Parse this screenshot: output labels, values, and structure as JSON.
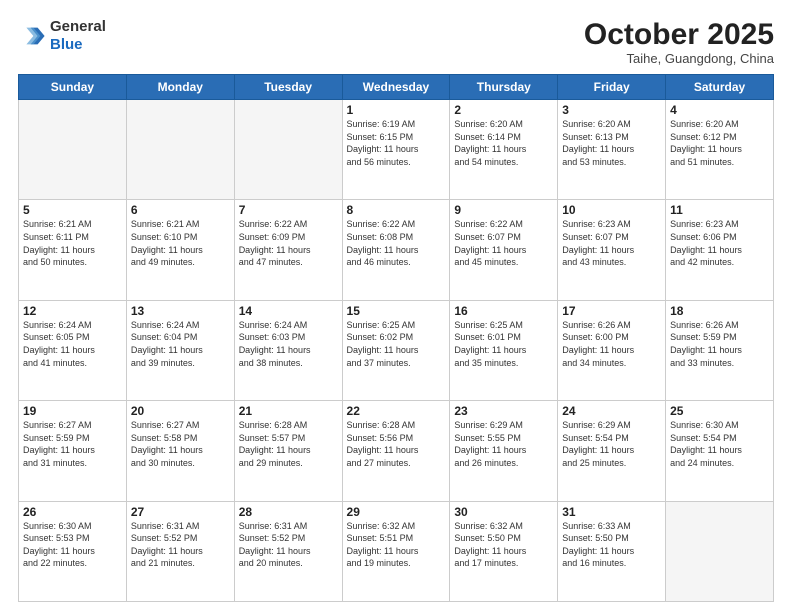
{
  "header": {
    "logo_general": "General",
    "logo_blue": "Blue",
    "month_title": "October 2025",
    "subtitle": "Taihe, Guangdong, China"
  },
  "weekdays": [
    "Sunday",
    "Monday",
    "Tuesday",
    "Wednesday",
    "Thursday",
    "Friday",
    "Saturday"
  ],
  "weeks": [
    [
      {
        "day": "",
        "info": ""
      },
      {
        "day": "",
        "info": ""
      },
      {
        "day": "",
        "info": ""
      },
      {
        "day": "1",
        "info": "Sunrise: 6:19 AM\nSunset: 6:15 PM\nDaylight: 11 hours\nand 56 minutes."
      },
      {
        "day": "2",
        "info": "Sunrise: 6:20 AM\nSunset: 6:14 PM\nDaylight: 11 hours\nand 54 minutes."
      },
      {
        "day": "3",
        "info": "Sunrise: 6:20 AM\nSunset: 6:13 PM\nDaylight: 11 hours\nand 53 minutes."
      },
      {
        "day": "4",
        "info": "Sunrise: 6:20 AM\nSunset: 6:12 PM\nDaylight: 11 hours\nand 51 minutes."
      }
    ],
    [
      {
        "day": "5",
        "info": "Sunrise: 6:21 AM\nSunset: 6:11 PM\nDaylight: 11 hours\nand 50 minutes."
      },
      {
        "day": "6",
        "info": "Sunrise: 6:21 AM\nSunset: 6:10 PM\nDaylight: 11 hours\nand 49 minutes."
      },
      {
        "day": "7",
        "info": "Sunrise: 6:22 AM\nSunset: 6:09 PM\nDaylight: 11 hours\nand 47 minutes."
      },
      {
        "day": "8",
        "info": "Sunrise: 6:22 AM\nSunset: 6:08 PM\nDaylight: 11 hours\nand 46 minutes."
      },
      {
        "day": "9",
        "info": "Sunrise: 6:22 AM\nSunset: 6:07 PM\nDaylight: 11 hours\nand 45 minutes."
      },
      {
        "day": "10",
        "info": "Sunrise: 6:23 AM\nSunset: 6:07 PM\nDaylight: 11 hours\nand 43 minutes."
      },
      {
        "day": "11",
        "info": "Sunrise: 6:23 AM\nSunset: 6:06 PM\nDaylight: 11 hours\nand 42 minutes."
      }
    ],
    [
      {
        "day": "12",
        "info": "Sunrise: 6:24 AM\nSunset: 6:05 PM\nDaylight: 11 hours\nand 41 minutes."
      },
      {
        "day": "13",
        "info": "Sunrise: 6:24 AM\nSunset: 6:04 PM\nDaylight: 11 hours\nand 39 minutes."
      },
      {
        "day": "14",
        "info": "Sunrise: 6:24 AM\nSunset: 6:03 PM\nDaylight: 11 hours\nand 38 minutes."
      },
      {
        "day": "15",
        "info": "Sunrise: 6:25 AM\nSunset: 6:02 PM\nDaylight: 11 hours\nand 37 minutes."
      },
      {
        "day": "16",
        "info": "Sunrise: 6:25 AM\nSunset: 6:01 PM\nDaylight: 11 hours\nand 35 minutes."
      },
      {
        "day": "17",
        "info": "Sunrise: 6:26 AM\nSunset: 6:00 PM\nDaylight: 11 hours\nand 34 minutes."
      },
      {
        "day": "18",
        "info": "Sunrise: 6:26 AM\nSunset: 5:59 PM\nDaylight: 11 hours\nand 33 minutes."
      }
    ],
    [
      {
        "day": "19",
        "info": "Sunrise: 6:27 AM\nSunset: 5:59 PM\nDaylight: 11 hours\nand 31 minutes."
      },
      {
        "day": "20",
        "info": "Sunrise: 6:27 AM\nSunset: 5:58 PM\nDaylight: 11 hours\nand 30 minutes."
      },
      {
        "day": "21",
        "info": "Sunrise: 6:28 AM\nSunset: 5:57 PM\nDaylight: 11 hours\nand 29 minutes."
      },
      {
        "day": "22",
        "info": "Sunrise: 6:28 AM\nSunset: 5:56 PM\nDaylight: 11 hours\nand 27 minutes."
      },
      {
        "day": "23",
        "info": "Sunrise: 6:29 AM\nSunset: 5:55 PM\nDaylight: 11 hours\nand 26 minutes."
      },
      {
        "day": "24",
        "info": "Sunrise: 6:29 AM\nSunset: 5:54 PM\nDaylight: 11 hours\nand 25 minutes."
      },
      {
        "day": "25",
        "info": "Sunrise: 6:30 AM\nSunset: 5:54 PM\nDaylight: 11 hours\nand 24 minutes."
      }
    ],
    [
      {
        "day": "26",
        "info": "Sunrise: 6:30 AM\nSunset: 5:53 PM\nDaylight: 11 hours\nand 22 minutes."
      },
      {
        "day": "27",
        "info": "Sunrise: 6:31 AM\nSunset: 5:52 PM\nDaylight: 11 hours\nand 21 minutes."
      },
      {
        "day": "28",
        "info": "Sunrise: 6:31 AM\nSunset: 5:52 PM\nDaylight: 11 hours\nand 20 minutes."
      },
      {
        "day": "29",
        "info": "Sunrise: 6:32 AM\nSunset: 5:51 PM\nDaylight: 11 hours\nand 19 minutes."
      },
      {
        "day": "30",
        "info": "Sunrise: 6:32 AM\nSunset: 5:50 PM\nDaylight: 11 hours\nand 17 minutes."
      },
      {
        "day": "31",
        "info": "Sunrise: 6:33 AM\nSunset: 5:50 PM\nDaylight: 11 hours\nand 16 minutes."
      },
      {
        "day": "",
        "info": ""
      }
    ]
  ]
}
